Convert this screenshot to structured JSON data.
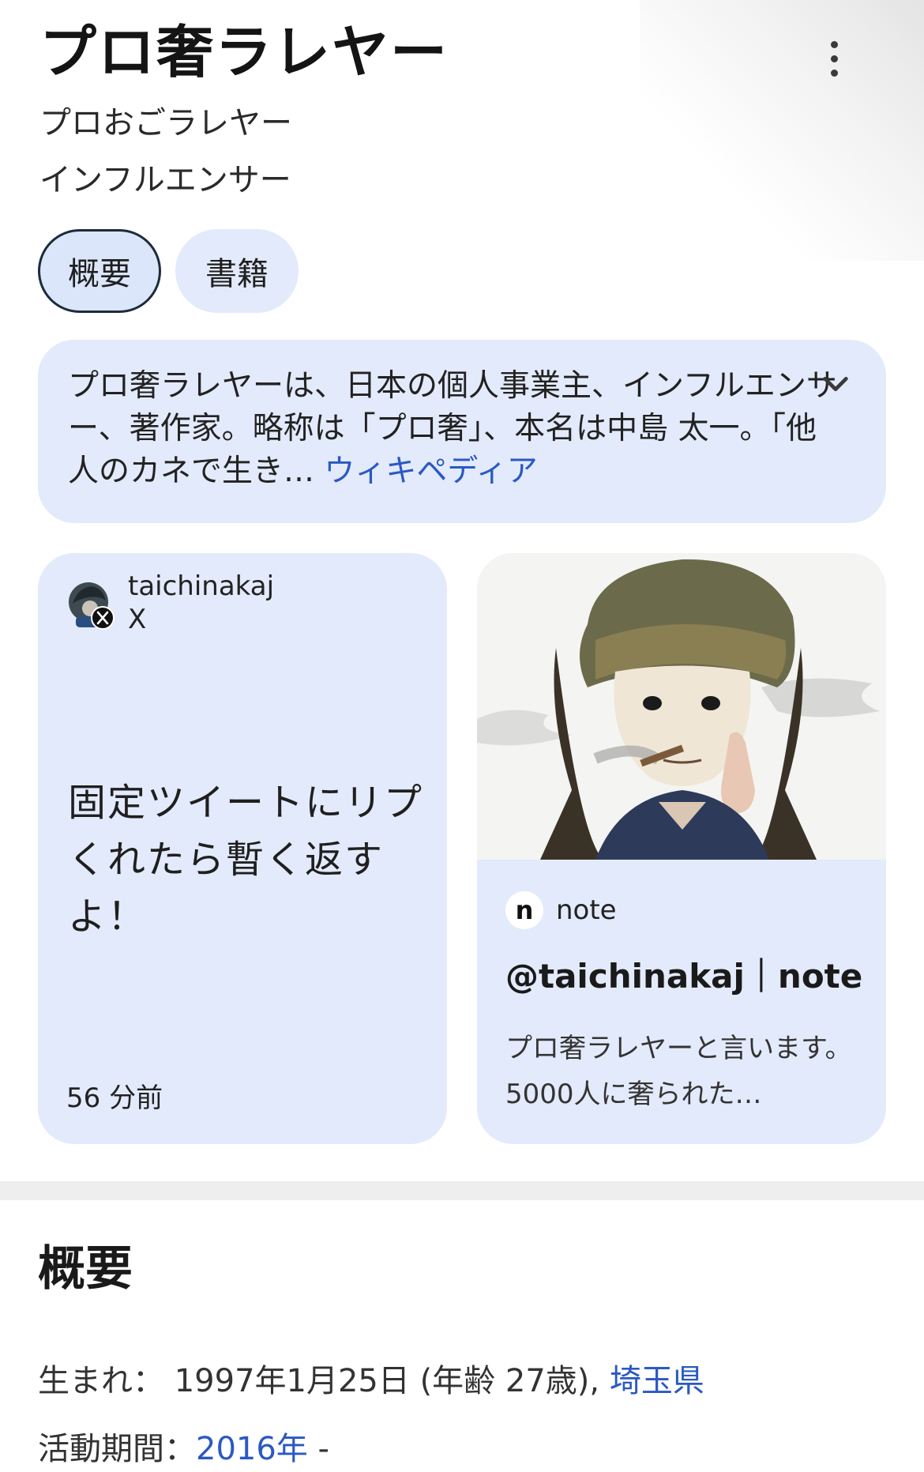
{
  "header": {
    "title": "プロ奢ラレヤー",
    "subtitle_1": "プロおごラレヤー",
    "subtitle_2": "インフルエンサー"
  },
  "chips": {
    "overview": "概要",
    "books": "書籍"
  },
  "description": {
    "text": "プロ奢ラレヤーは、日本の個人事業主、インフルエンサー、著作家。略称は「プロ奢」、本名は中島 太一。「他人のカネで生き",
    "ellipsis": "…",
    "source": "ウィキペディア"
  },
  "x_card": {
    "username": "taichinakaj",
    "source": "X",
    "tweet": "固定ツイートにリプくれたら暫く返すよ！",
    "time": "56 分前"
  },
  "note_card": {
    "logo": "n",
    "source": "note",
    "title": "@taichinakaj｜note",
    "snippet": "プロ奢ラレヤーと言います。 5000人に奢られた…"
  },
  "overview": {
    "heading": "概要",
    "born_label": "生まれ：",
    "born_value": " 1997年1月25日 (年齢 27歳), ",
    "born_place": "埼玉県",
    "active_label": "活動期間：",
    "active_value": "2016年",
    "active_suffix": " -"
  },
  "colors": {
    "card_bg": "#e3eafb",
    "link": "#2a59c2",
    "chip_active_border": "#1d2b3a"
  },
  "icons": {
    "more": "more-vert-icon",
    "chevron": "chevron-down-icon",
    "x_logo": "x-logo-icon",
    "note_logo": "note-logo-icon"
  }
}
